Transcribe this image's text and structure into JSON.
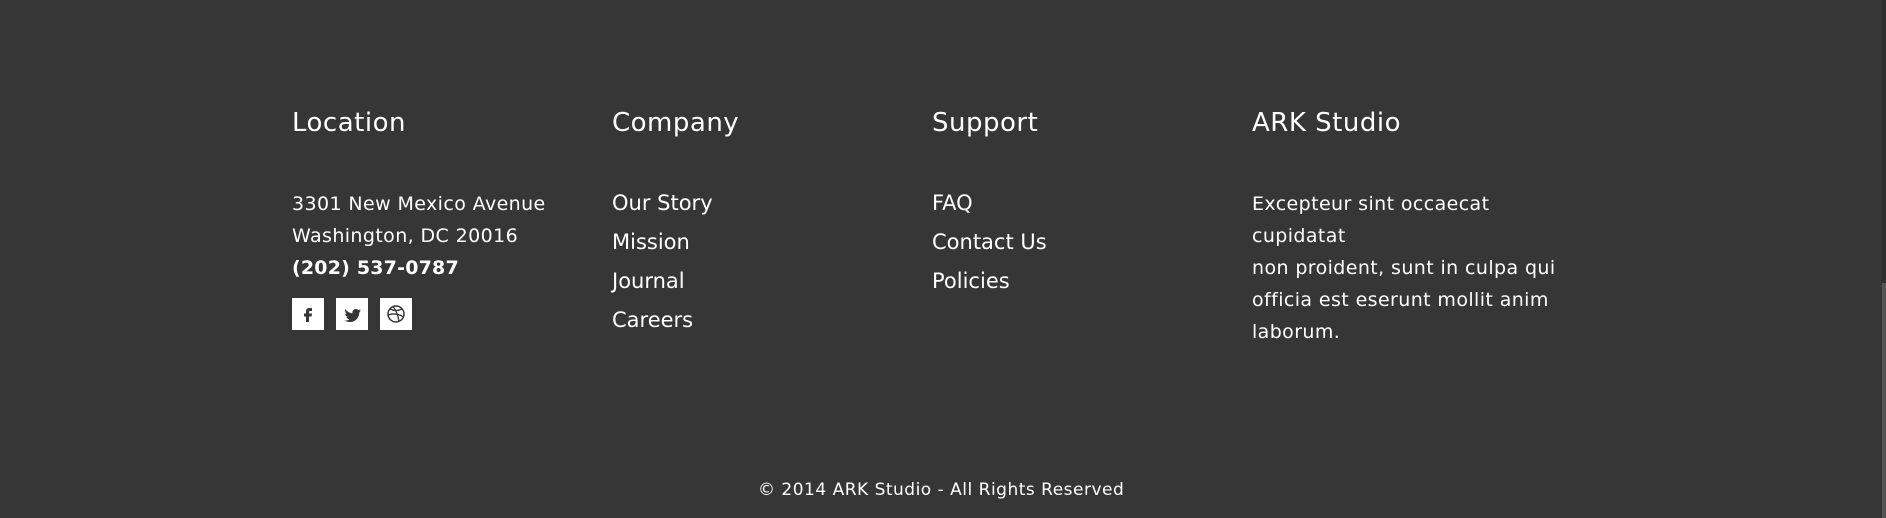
{
  "location": {
    "heading": "Location",
    "address_line1": "3301 New Mexico Avenue",
    "address_line2": "Washington, DC 20016",
    "phone": "(202) 537-0787",
    "social_icons": [
      "facebook-icon",
      "twitter-icon",
      "dribbble-icon"
    ]
  },
  "company": {
    "heading": "Company",
    "links": [
      "Our Story",
      "Mission",
      "Journal",
      "Careers"
    ]
  },
  "support": {
    "heading": "Support",
    "links": [
      "FAQ",
      "Contact Us",
      "Policies"
    ]
  },
  "ark": {
    "heading": "ARK Studio",
    "about_line1": "Excepteur sint occaecat cupidatat",
    "about_line2": "non proident, sunt in culpa qui",
    "about_line3": "officia est eserunt mollit anim",
    "about_line4": "laborum."
  },
  "copyright": "© 2014 ARK Studio - All Rights Reserved",
  "colors": {
    "background": "#363636",
    "text": "#ffffff",
    "icon_bg": "#ffffff",
    "icon_fg": "#363636"
  }
}
